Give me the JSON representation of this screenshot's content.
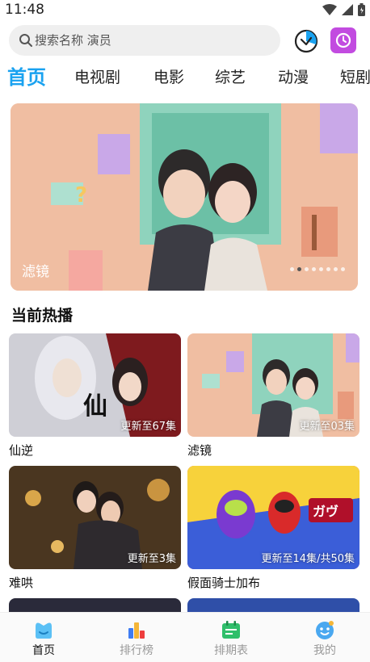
{
  "status_bar": {
    "time": "11:48"
  },
  "search": {
    "placeholder": "搜索名称 演员"
  },
  "tabs": [
    {
      "label": "首页",
      "active": true
    },
    {
      "label": "电视剧"
    },
    {
      "label": "电影"
    },
    {
      "label": "综艺"
    },
    {
      "label": "动漫"
    },
    {
      "label": "短剧"
    }
  ],
  "banner": {
    "title": "滤镜",
    "dots_count": 8,
    "active_dot": 1
  },
  "section": {
    "title": "当前热播"
  },
  "cards": [
    {
      "name": "仙逆",
      "badge": "更新至67集"
    },
    {
      "name": "滤镜",
      "badge": "更新至03集"
    },
    {
      "name": "难哄",
      "badge": "更新至3集"
    },
    {
      "name": "假面骑士加布",
      "badge": "更新至14集/共50集"
    }
  ],
  "bottom_nav": [
    {
      "label": "首页",
      "icon": "home-icon",
      "active": true
    },
    {
      "label": "排行榜",
      "icon": "ranking-icon"
    },
    {
      "label": "排期表",
      "icon": "calendar-icon"
    },
    {
      "label": "我的",
      "icon": "profile-icon"
    }
  ],
  "colors": {
    "accent": "#1aa2f0",
    "clock_button": "#c24be0"
  }
}
